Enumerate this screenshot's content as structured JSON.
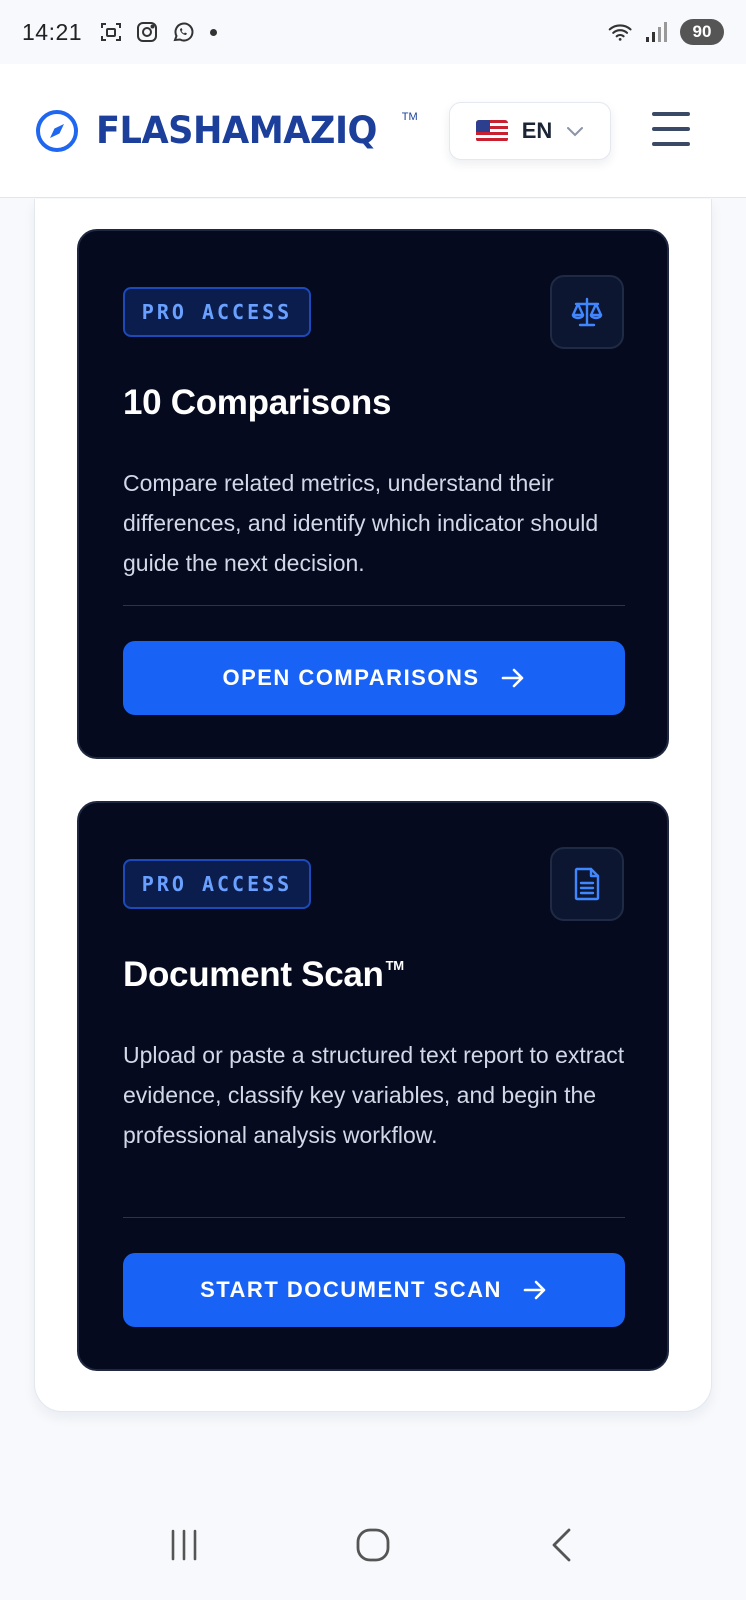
{
  "status_bar": {
    "time": "14:21",
    "battery": "90"
  },
  "header": {
    "brand": "FLASHAMAZIQ",
    "brand_tm": "TM",
    "language": "EN"
  },
  "cards": [
    {
      "badge": "PRO ACCESS",
      "icon": "scale-icon",
      "title": "10 Comparisons",
      "title_tm": "",
      "description": "Compare related metrics, understand their differences, and identify which indicator should guide the next decision.",
      "cta": "OPEN COMPARISONS"
    },
    {
      "badge": "PRO ACCESS",
      "icon": "document-icon",
      "title": "Document Scan",
      "title_tm": "TM",
      "description": "Upload or paste a structured text report to extract evidence, classify key variables, and begin the professional analysis workflow.",
      "cta": "START DOCUMENT SCAN"
    }
  ],
  "colors": {
    "brand": "#1b3f9a",
    "card_bg": "#050a1e",
    "accent": "#1863f5",
    "badge_text": "#6aa0ff"
  }
}
